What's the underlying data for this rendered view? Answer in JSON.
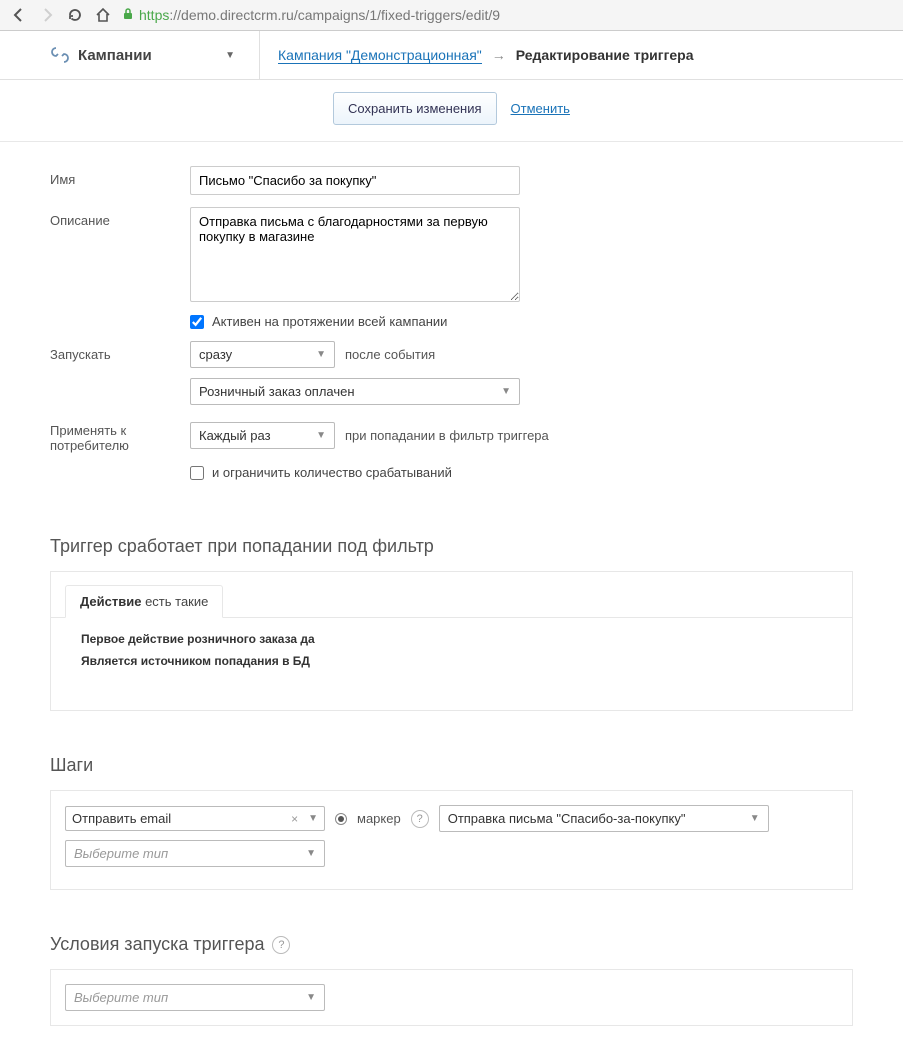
{
  "browser": {
    "url_https": "https",
    "url_rest": "://demo.directcrm.ru/campaigns/1/fixed-triggers/edit/9"
  },
  "header": {
    "campaigns_label": "Кампании",
    "breadcrumb_link": "Кампания \"Демонстрационная\"",
    "breadcrumb_current": "Редактирование триггера"
  },
  "actions": {
    "save": "Сохранить изменения",
    "cancel": "Отменить"
  },
  "form": {
    "name_label": "Имя",
    "name_value": "Письмо \"Спасибо за покупку\"",
    "desc_label": "Описание",
    "desc_value": "Отправка письма с благодарностями за первую покупку в магазине",
    "active_label": "Активен на протяжении всей кампании",
    "launch_label": "Запускать",
    "launch_value": "сразу",
    "after_event_label": "после события",
    "event_value": "Розничный заказ оплачен",
    "apply_label": "Применять к потребителю",
    "apply_value": "Каждый раз",
    "apply_hint": "при попадании в фильтр триггера",
    "limit_label": "и ограничить количество срабатываний"
  },
  "filter": {
    "title": "Триггер сработает при попадании под фильтр",
    "tab_bold": "Действие",
    "tab_light": "есть такие",
    "line1": "Первое действие розничного заказа да",
    "line2": "Является источником попадания в БД"
  },
  "steps": {
    "title": "Шаги",
    "action_value": "Отправить email",
    "marker_label": "маркер",
    "template_value": "Отправка письма \"Спасибо-за-покупку\"",
    "type_placeholder": "Выберите тип"
  },
  "conditions": {
    "title": "Условия запуска триггера",
    "type_placeholder": "Выберите тип"
  }
}
